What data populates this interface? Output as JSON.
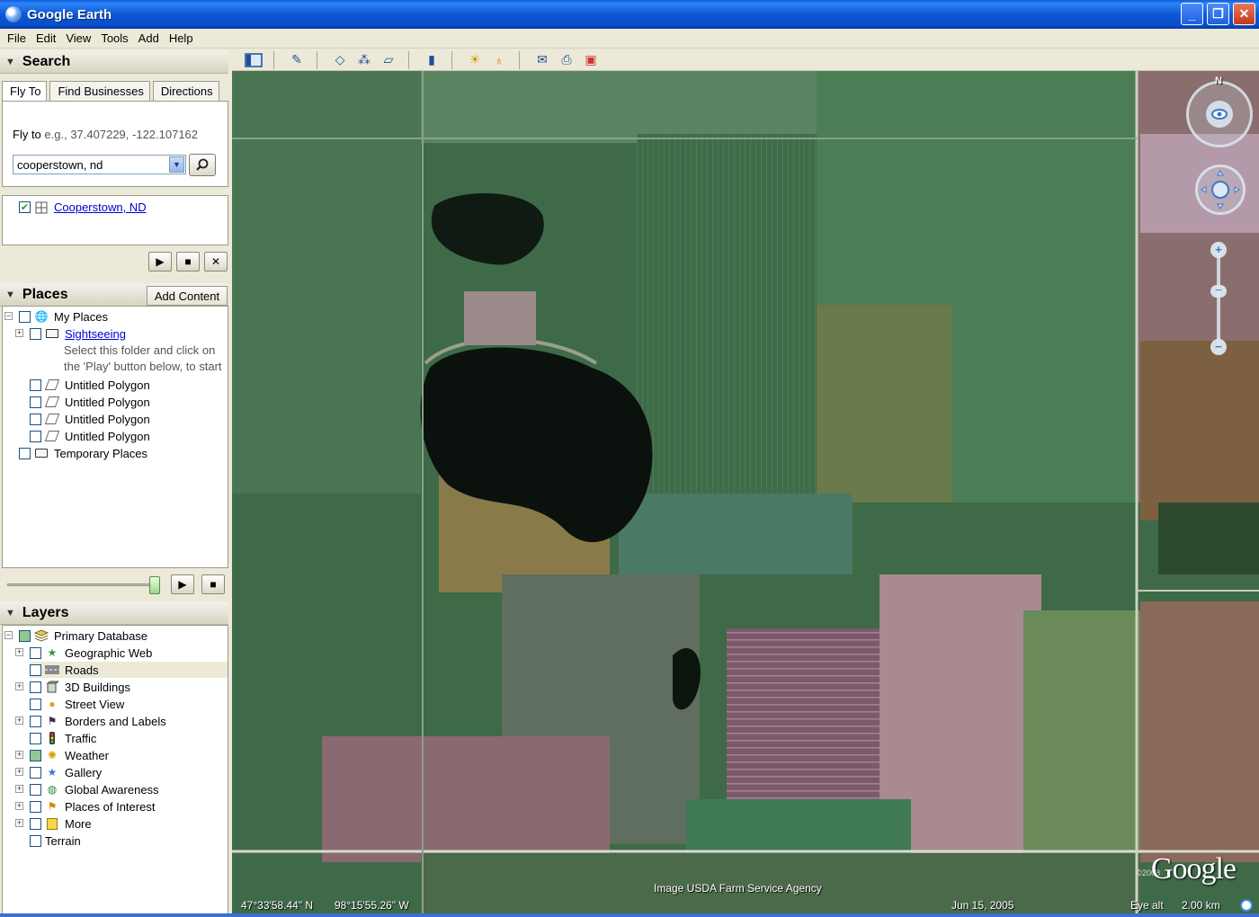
{
  "window": {
    "title": "Google Earth"
  },
  "menu": [
    "File",
    "Edit",
    "View",
    "Tools",
    "Add",
    "Help"
  ],
  "search": {
    "header": "Search",
    "tabs": [
      "Fly To",
      "Find Businesses",
      "Directions"
    ],
    "flyto_label": "Fly to",
    "flyto_hint": "e.g., 37.407229, -122.107162",
    "query": "cooperstown, nd",
    "result": "Cooperstown, ND"
  },
  "places": {
    "header": "Places",
    "add_content": "Add Content",
    "my_places": "My Places",
    "sightseeing": "Sightseeing",
    "sightseeing_desc_1": "Select this folder and click on",
    "sightseeing_desc_2": "the 'Play' button below, to start",
    "polygons": [
      "Untitled Polygon",
      "Untitled Polygon",
      "Untitled Polygon",
      "Untitled Polygon"
    ],
    "temporary": "Temporary Places"
  },
  "layers": {
    "header": "Layers",
    "primary": "Primary Database",
    "items": [
      "Geographic Web",
      "Roads",
      "3D Buildings",
      "Street View",
      "Borders and Labels",
      "Traffic",
      "Weather",
      "Gallery",
      "Global Awareness",
      "Places of Interest",
      "More"
    ],
    "terrain": "Terrain"
  },
  "map": {
    "image_credit": "Image USDA Farm Service Agency",
    "copyright": "©2008",
    "logo": "Google",
    "latitude": "47°33'58.44\" N",
    "longitude": "98°15'55.26\" W",
    "date": "Jun 15, 2005",
    "eye_alt_label": "Eye alt",
    "eye_alt_value": "2.00 km",
    "north_label": "N"
  },
  "colors": {
    "titlebar": "#0a57d8",
    "link": "#0000cc",
    "panel": "#ece9d8"
  }
}
